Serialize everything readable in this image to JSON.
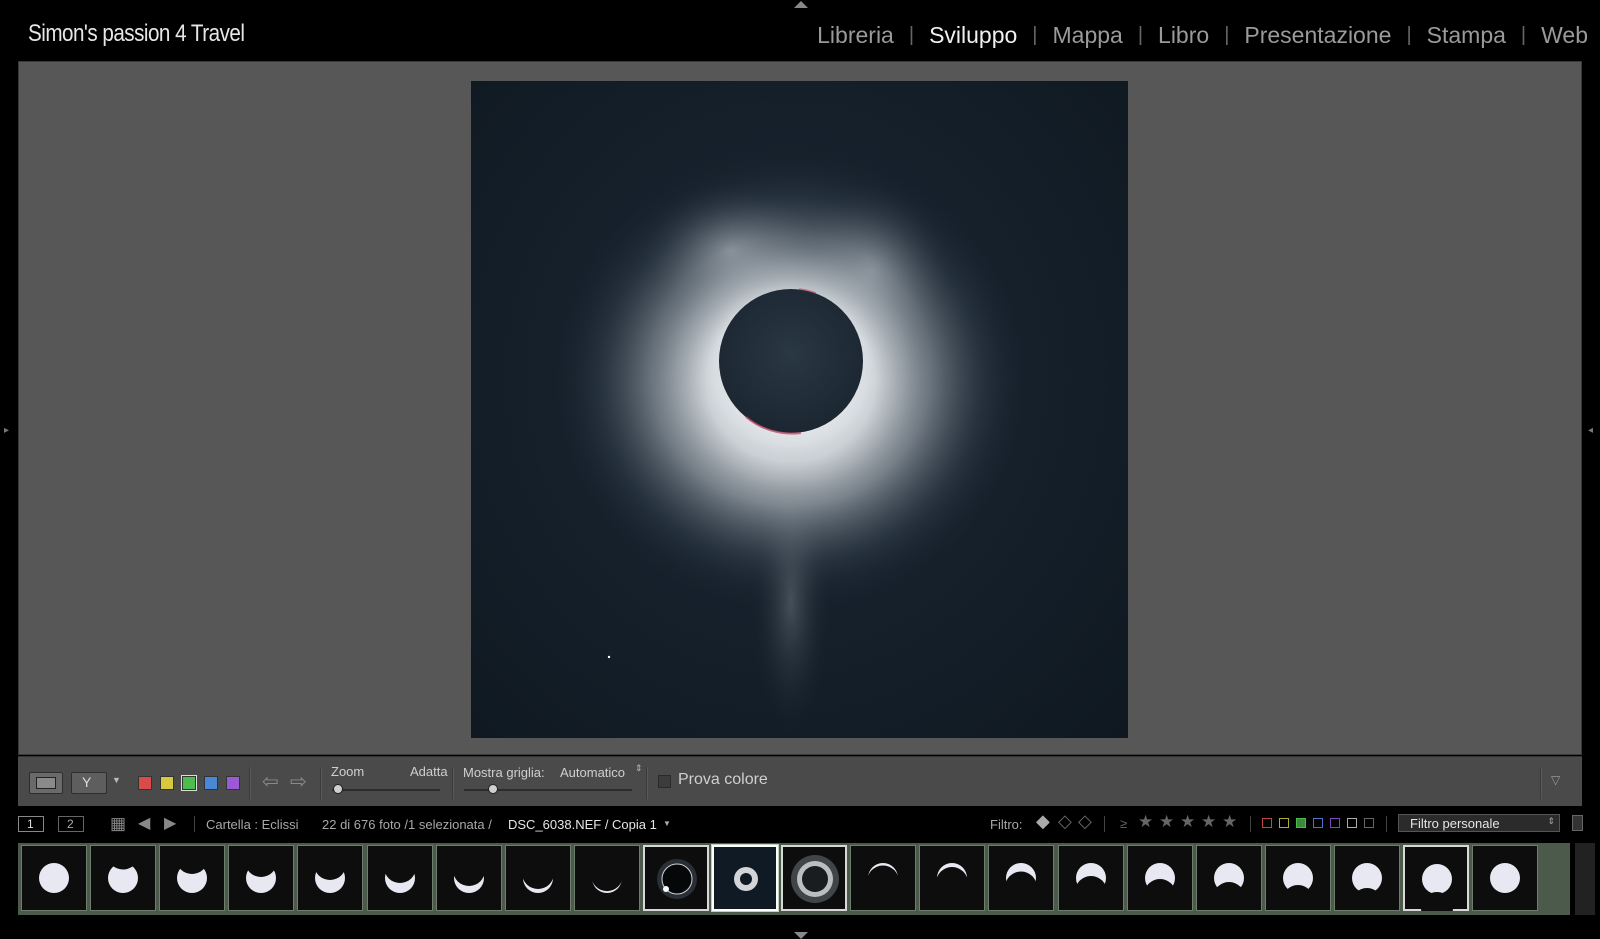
{
  "brand": "Simon's passion 4 Travel",
  "modules": [
    {
      "label": "Libreria",
      "active": false
    },
    {
      "label": "Sviluppo",
      "active": true
    },
    {
      "label": "Mappa",
      "active": false
    },
    {
      "label": "Libro",
      "active": false
    },
    {
      "label": "Presentazione",
      "active": false
    },
    {
      "label": "Stampa",
      "active": false
    },
    {
      "label": "Web",
      "active": false
    }
  ],
  "toolbar": {
    "color_labels": [
      "#d94a4a",
      "#d6c93c",
      "#4dbb4d",
      "#4a87d6",
      "#9a5ad6"
    ],
    "zoom_label": "Zoom",
    "zoom_value": "Adatta",
    "grid_label": "Mostra griglia:",
    "grid_value": "Automatico",
    "proof_label": "Prova colore"
  },
  "filmstrip_header": {
    "view1": "1",
    "view2": "2",
    "source": "Cartella : Eclissi",
    "count": "22 di 676 foto /1 selezionata /",
    "filename": "DSC_6038.NEF / Copia 1",
    "filter_label": "Filtro:",
    "rating_op": "≥",
    "filter_preset": "Filtro personale"
  },
  "filmstrip": {
    "thumbs": [
      {
        "kind": "full",
        "phase": 0
      },
      {
        "kind": "partial",
        "phase": 0.25
      },
      {
        "kind": "partial",
        "phase": 0.4
      },
      {
        "kind": "partial",
        "phase": 0.5
      },
      {
        "kind": "partial",
        "phase": 0.6
      },
      {
        "kind": "partial",
        "phase": 0.7
      },
      {
        "kind": "partial",
        "phase": 0.8
      },
      {
        "kind": "partial",
        "phase": 0.9
      },
      {
        "kind": "partial",
        "phase": 0.97
      },
      {
        "kind": "diamond",
        "phase": 1
      },
      {
        "kind": "total",
        "phase": 1
      },
      {
        "kind": "corona",
        "phase": 1
      },
      {
        "kind": "partialR",
        "phase": 0.95
      },
      {
        "kind": "partialR",
        "phase": 0.9
      },
      {
        "kind": "partialR",
        "phase": 0.75
      },
      {
        "kind": "partialR",
        "phase": 0.6
      },
      {
        "kind": "partialR",
        "phase": 0.5
      },
      {
        "kind": "partialR",
        "phase": 0.4
      },
      {
        "kind": "partialR",
        "phase": 0.3
      },
      {
        "kind": "partialR",
        "phase": 0.2
      },
      {
        "kind": "partialR",
        "phase": 0.1
      },
      {
        "kind": "full",
        "phase": 0
      }
    ],
    "selected_index": 10,
    "highlighted_indices": [
      9,
      10,
      11,
      20
    ]
  }
}
